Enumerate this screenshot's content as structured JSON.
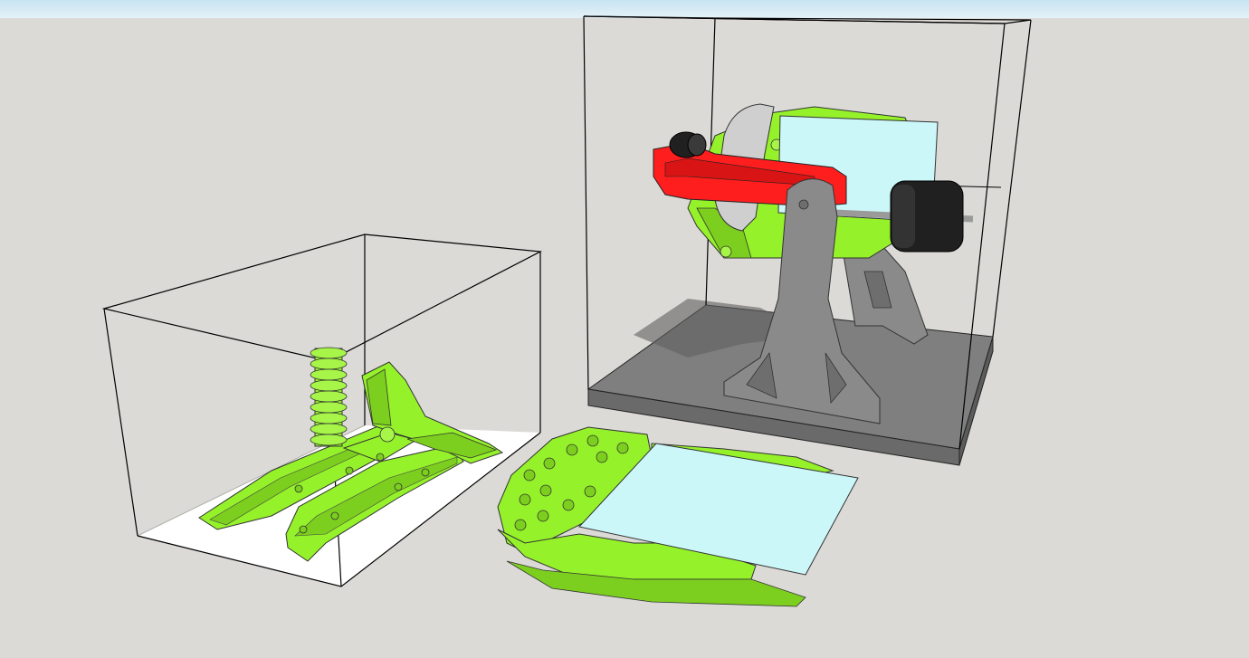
{
  "viewport": {
    "sky_color": "#c8e4f2",
    "ground_color": "#dcdad7"
  },
  "colors": {
    "part_green": "#95f22a",
    "part_green_dark": "#7ccf1e",
    "red_frame": "#ff1e1e",
    "gray_stand": "#8a8a8a",
    "base_plate": "#7f7f7f",
    "glass": "#ccf7f9",
    "tire": "#202020",
    "outline": "#000000",
    "bbox_fill": "#ffffff"
  }
}
